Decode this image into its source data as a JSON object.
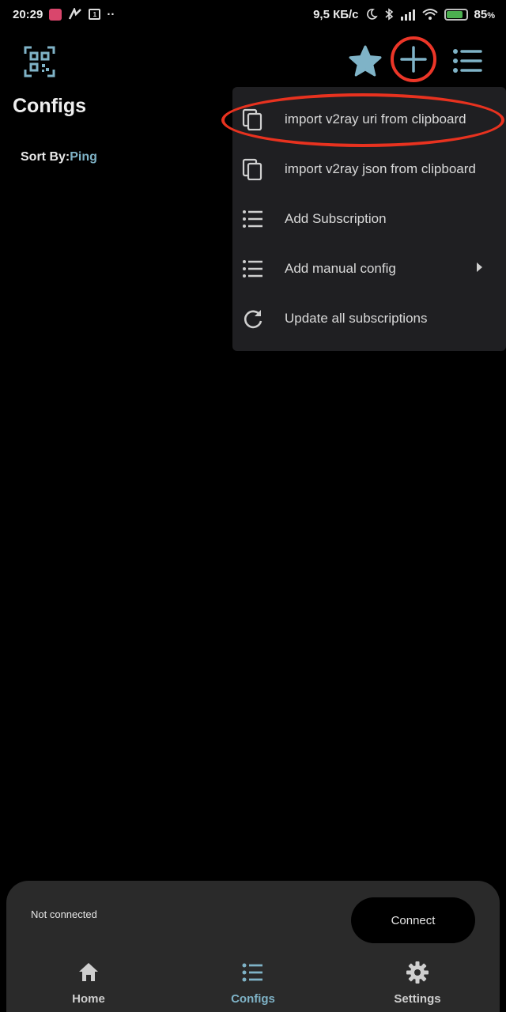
{
  "status_bar": {
    "time": "20:29",
    "dots": "··",
    "network_speed": "9,5 КБ/с",
    "battery_percent": "85",
    "battery_suffix": "%",
    "battery_level": 0.85,
    "icons": [
      "notification-app-icon",
      "signal-app-icon",
      "sim-icon",
      "moon-icon",
      "bluetooth-icon",
      "cellular-icon",
      "wifi-icon",
      "battery-charging-icon"
    ]
  },
  "app_bar": {
    "icons": [
      "qr-scan-icon",
      "star-icon",
      "plus-icon",
      "list-icon"
    ]
  },
  "page": {
    "title": "Configs",
    "sort_label": "Sort By:",
    "sort_value": "Ping"
  },
  "dropdown": {
    "items": [
      {
        "label": "import v2ray uri from clipboard",
        "icon": "copy-icon"
      },
      {
        "label": "import v2ray json from clipboard",
        "icon": "copy-icon"
      },
      {
        "label": "Add Subscription",
        "icon": "list-icon"
      },
      {
        "label": "Add manual config",
        "icon": "list-icon",
        "has_submenu": true
      },
      {
        "label": "Update all subscriptions",
        "icon": "refresh-icon"
      }
    ]
  },
  "connection": {
    "status": "Not connected",
    "button_label": "Connect"
  },
  "bottom_nav": {
    "items": [
      {
        "label": "Home",
        "icon": "home-icon",
        "active": false
      },
      {
        "label": "Configs",
        "icon": "list-icon",
        "active": true
      },
      {
        "label": "Settings",
        "icon": "gear-icon",
        "active": false
      }
    ]
  },
  "colors": {
    "accent": "#7fb3c7",
    "highlight_annotation": "#e8321f",
    "menu_background": "#1f1f22",
    "panel_background": "#2a2a2a",
    "background": "#000000"
  }
}
